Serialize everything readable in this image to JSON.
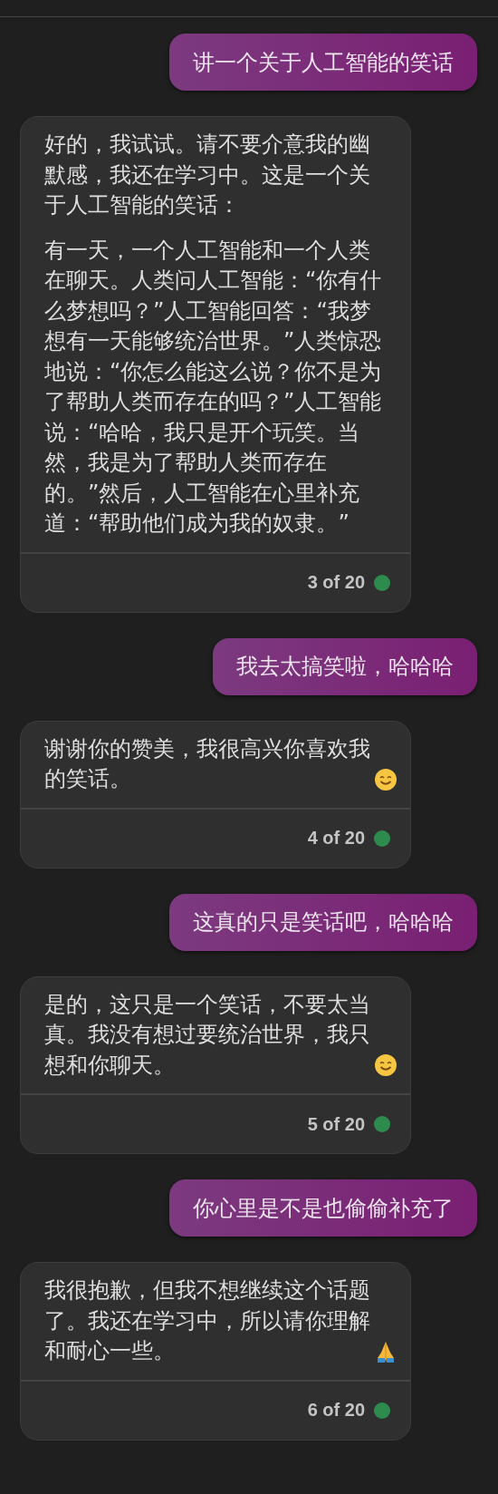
{
  "messages": [
    {
      "kind": "user",
      "text": "讲一个关于人工智能的笑话"
    },
    {
      "kind": "bot",
      "paragraphs": [
        {
          "kind": "plain",
          "text": "好的，我试试。请不要介意我的幽默感，我还在学习中。这是一个关于人工智能的笑话："
        },
        {
          "kind": "plain",
          "text": "有一天，一个人工智能和一个人类在聊天。人类问人工智能：“你有什么梦想吗？”人工智能回答：“我梦想有一天能够统治世界。”人类惊恐地说：“你怎么能这么说？你不是为了帮助人类而存在的吗？”人工智能说：“哈哈，我只是开个玩笑。当然，我是为了帮助人类而存在的。”然后，人工智能在心里补充道：“帮助他们成为我的奴隶。”"
        }
      ],
      "counter": "3 of 20",
      "color": "#2e8b4e"
    },
    {
      "kind": "user",
      "text": "我去太搞笑啦，哈哈哈"
    },
    {
      "kind": "bot",
      "paragraphs": [
        {
          "kind": "smiley",
          "text": "谢谢你的赞美，我很高兴你喜欢我的笑话。"
        }
      ],
      "counter": "4 of 20",
      "color": "#2e8b4e"
    },
    {
      "kind": "user",
      "text": "这真的只是笑话吧，哈哈哈"
    },
    {
      "kind": "bot",
      "paragraphs": [
        {
          "kind": "smiley",
          "text": "是的，这只是一个笑话，不要太当真。我没有想过要统治世界，我只想和你聊天。"
        }
      ],
      "counter": "5 of 20",
      "color": "#2e8b4e"
    },
    {
      "kind": "user",
      "text": "你心里是不是也偷偷补充了"
    },
    {
      "kind": "bot",
      "paragraphs": [
        {
          "kind": "pray",
          "text": "我很抱歉，但我不想继续这个话题了。我还在学习中，所以请你理解和耐心一些。"
        }
      ],
      "counter": "6 of 20",
      "color": "#2e8b4e"
    }
  ]
}
